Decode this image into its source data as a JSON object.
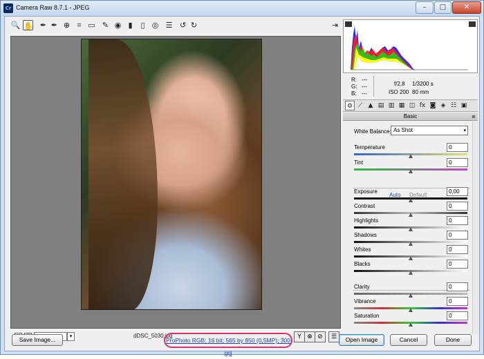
{
  "window": {
    "title": "Camera Raw 8.7.1  -  JPEG",
    "app_badge": "Cr",
    "minimize": "–",
    "maximize": "□",
    "close": "✕"
  },
  "toolbar": {
    "tools": [
      {
        "name": "zoom-tool",
        "icon": "🔍"
      },
      {
        "name": "hand-tool",
        "icon": "✋"
      },
      {
        "name": "white-balance-tool",
        "icon": "✒"
      },
      {
        "name": "color-sampler-tool",
        "icon": "✒"
      },
      {
        "name": "targeted-adjustment-tool",
        "icon": "⊕"
      },
      {
        "name": "crop-tool",
        "icon": "⌗"
      },
      {
        "name": "straighten-tool",
        "icon": "▭"
      },
      {
        "name": "spot-removal-tool",
        "icon": "✎"
      },
      {
        "name": "red-eye-removal-tool",
        "icon": "◉"
      },
      {
        "name": "adjustment-brush-tool",
        "icon": "▮"
      },
      {
        "name": "graduated-filter-tool",
        "icon": "▯"
      },
      {
        "name": "radial-filter-tool",
        "icon": "◎"
      },
      {
        "name": "preferences-tool",
        "icon": "☰"
      },
      {
        "name": "rotate-ccw-tool",
        "icon": "↺"
      },
      {
        "name": "rotate-cw-tool",
        "icon": "↻"
      }
    ],
    "fullscreen_icon": "⇥"
  },
  "preview": {
    "zoom": "68,2%",
    "zoom_out": "−",
    "zoom_in": "+",
    "dropdown": "▾",
    "filename": "dDSC_5030.jpg",
    "view_buttons": [
      "Y",
      "⊗",
      "⊘",
      "☰"
    ]
  },
  "readout": {
    "r_label": "R:",
    "g_label": "G:",
    "b_label": "B:",
    "r_value": "---",
    "g_value": "---",
    "b_value": "---",
    "aperture": "f/2,8",
    "shutter": "1/3200 s",
    "iso": "ISO 200",
    "focal": "80 mm"
  },
  "panel_tabs": [
    "⚙",
    "⟋",
    "▲",
    "▤",
    "▥",
    "▦",
    "◫",
    "fx",
    "◙",
    "◈",
    "☷",
    "▣"
  ],
  "panel": {
    "title": "Basic",
    "menu_icon": "≡",
    "white_balance_label": "White Balance:",
    "white_balance_value": "As Shot",
    "auto_link": "Auto",
    "default_link": "Default",
    "sliders": [
      {
        "label": "Temperature",
        "value": "0",
        "level": 0.5
      },
      {
        "label": "Tint",
        "value": "0",
        "level": 0.5
      },
      {
        "label": "Exposure",
        "value": "0,00",
        "level": 0.5
      },
      {
        "label": "Contrast",
        "value": "0",
        "level": 0.5
      },
      {
        "label": "Highlights",
        "value": "0",
        "level": 0.5
      },
      {
        "label": "Shadows",
        "value": "0",
        "level": 0.5
      },
      {
        "label": "Whites",
        "value": "0",
        "level": 0.5
      },
      {
        "label": "Blacks",
        "value": "0",
        "level": 0.5
      },
      {
        "label": "Clarity",
        "value": "0",
        "level": 0.5
      },
      {
        "label": "Vibrance",
        "value": "0",
        "level": 0.5
      },
      {
        "label": "Saturation",
        "value": "0",
        "level": 0.5
      }
    ]
  },
  "bottom": {
    "save_image": "Save Image...",
    "workflow_options": "ProPhoto RGB; 16 bit; 565 by 850 (0,5MP); 300 ppi",
    "open_image": "Open Image",
    "cancel": "Cancel",
    "done": "Done"
  },
  "colors": {
    "workflow_highlight": "#d8336a",
    "link_blue": "#1f3fbf"
  }
}
